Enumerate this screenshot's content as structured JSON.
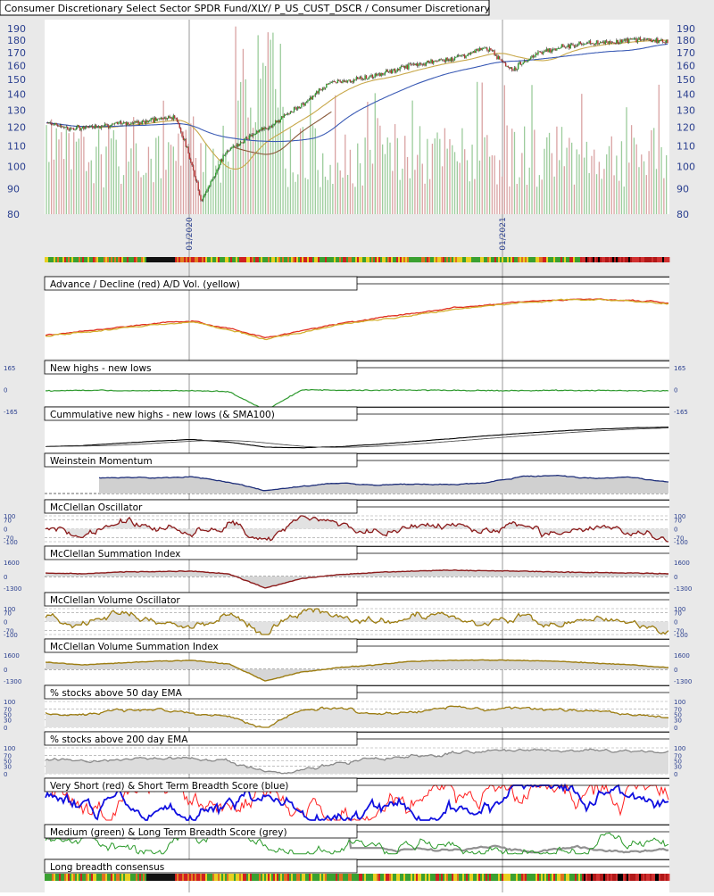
{
  "colors": {
    "background": "#e9e9e9",
    "plot_background": "#ffffff",
    "axis_text": "#2a3f8f",
    "candle_up": "#2e9e2e",
    "candle_down": "#b33333",
    "volume_up": "#9ccc9c",
    "volume_down": "#d9a3a3",
    "sma_gold": "#c8a84a",
    "sma_blue": "#3b5bb5",
    "sma_brown": "#8a5a3a",
    "advance_decline": "#e03020",
    "ad_volume": "#d4b030",
    "nhnl": "#2f9a2f",
    "cumulative": "#000000",
    "weinstein": "#1f2f7a",
    "mcclellan": "#8b1a1a",
    "volume_osc": "#9c7c10",
    "pct50": "#9c7c10",
    "pct200": "#8a8a8a",
    "very_short": "#ff2020",
    "short": "#1010e0",
    "medium": "#2a9a2a",
    "long": "#909090",
    "fill_grey": "#d0d0d0"
  },
  "chart_data": [
    {
      "type": "candlestick",
      "title": "Consumer Discretionary Select Sector SPDR Fund/XLY/ P_US_CUST_DSCR / Consumer Discretionary",
      "y_ticks": [
        190,
        180,
        170,
        160,
        150,
        140,
        130,
        120,
        110,
        100,
        90,
        80
      ],
      "y_scale": "log",
      "ylim": [
        80,
        195
      ],
      "date_labels": [
        "01/2020",
        "01/2021"
      ],
      "series": [
        {
          "name": "price",
          "x": [
            "2019-09",
            "2019-10",
            "2019-11",
            "2019-12",
            "2020-01",
            "2020-02",
            "2020-03",
            "2020-04",
            "2020-05",
            "2020-06",
            "2020-07",
            "2020-08",
            "2020-09",
            "2020-10",
            "2020-11",
            "2020-12",
            "2021-01",
            "2021-02",
            "2021-03",
            "2021-04",
            "2021-05",
            "2021-06",
            "2021-07",
            "2021-08",
            "2021-09"
          ],
          "values": [
            123,
            119,
            121,
            122,
            124,
            126,
            85,
            108,
            116,
            124,
            135,
            148,
            150,
            154,
            160,
            163,
            167,
            174,
            157,
            170,
            175,
            178,
            179,
            181,
            179
          ]
        }
      ],
      "overlays": [
        "SMA (gold)",
        "SMA (blue)",
        "SMA (brown)"
      ],
      "volume": "bars, green up / red down"
    },
    {
      "type": "heatmap",
      "title": "",
      "description_bar": "daily score colors (green / yellow / red / black)"
    },
    {
      "type": "line",
      "title": "Advance / Decline (red) A/D Vol. (yellow)",
      "series": [
        {
          "name": "Advance / Decline",
          "values": [
            0.35,
            0.42,
            0.48,
            0.56,
            0.6,
            0.48,
            0.3,
            0.43,
            0.55,
            0.65,
            0.73,
            0.82,
            0.88,
            0.94,
            0.97,
            0.98,
            0.96,
            0.92
          ]
        },
        {
          "name": "A/D Vol.",
          "values": [
            0.33,
            0.4,
            0.46,
            0.54,
            0.58,
            0.45,
            0.28,
            0.4,
            0.53,
            0.62,
            0.7,
            0.79,
            0.86,
            0.92,
            0.96,
            0.97,
            0.95,
            0.9
          ]
        }
      ]
    },
    {
      "type": "line",
      "title": "New highs - new lows",
      "y_ticks": [
        165,
        0,
        -165
      ],
      "series": [
        {
          "name": "new highs - new lows",
          "values": [
            0,
            5,
            2,
            3,
            0,
            -4,
            -165,
            10,
            5,
            6,
            8,
            4,
            3,
            2,
            4,
            3,
            1,
            0
          ]
        }
      ]
    },
    {
      "type": "line",
      "title": "Cummulative new highs - new lows (& SMA100)",
      "series": [
        {
          "name": "cumulative",
          "values": [
            0.1,
            0.15,
            0.25,
            0.35,
            0.42,
            0.3,
            0.08,
            0.05,
            0.1,
            0.2,
            0.32,
            0.45,
            0.58,
            0.7,
            0.8,
            0.88,
            0.94,
            0.98
          ]
        }
      ]
    },
    {
      "type": "line",
      "title": "Weinstein Momentum",
      "series": [
        {
          "name": "momentum",
          "values": [
            0.5,
            0.75,
            0.8,
            0.78,
            0.82,
            0.6,
            0.2,
            0.4,
            0.55,
            0.45,
            0.5,
            0.48,
            0.55,
            0.85,
            0.88,
            0.75,
            0.82,
            0.6
          ]
        }
      ]
    },
    {
      "type": "line",
      "title": "McClellan Oscillator",
      "y_ticks": [
        100,
        70,
        0,
        -70,
        -100
      ],
      "series": [
        {
          "name": "McClellan Oscillator",
          "values": [
            20,
            -40,
            60,
            10,
            -30,
            50,
            -100,
            90,
            40,
            -30,
            20,
            55,
            -20,
            30,
            -40,
            20,
            -30,
            -60
          ]
        }
      ]
    },
    {
      "type": "line",
      "title": "McClellan Summation Index",
      "y_ticks": [
        1600,
        0,
        -1300
      ],
      "series": [
        {
          "name": "Summation Index",
          "values": [
            400,
            300,
            500,
            550,
            600,
            300,
            -1300,
            -200,
            200,
            450,
            600,
            700,
            650,
            600,
            500,
            450,
            400,
            300
          ]
        }
      ]
    },
    {
      "type": "line",
      "title": "McClellan Volume Oscillator",
      "y_ticks": [
        100,
        70,
        0,
        -70,
        -100
      ],
      "series": [
        {
          "name": "Volume Oscillator",
          "values": [
            30,
            -20,
            70,
            10,
            -40,
            40,
            -100,
            100,
            50,
            -20,
            30,
            60,
            -10,
            40,
            -30,
            20,
            -20,
            -70
          ]
        }
      ]
    },
    {
      "type": "area",
      "title": "McClellan Volume Summation Index",
      "y_ticks": [
        1600,
        0,
        -1300
      ],
      "series": [
        {
          "name": "Volume Summation",
          "values": [
            800,
            500,
            700,
            900,
            1000,
            600,
            -1300,
            -300,
            200,
            500,
            900,
            1000,
            1050,
            1000,
            900,
            700,
            500,
            200
          ]
        }
      ]
    },
    {
      "type": "line",
      "title": "% stocks above 50 day EMA",
      "y_ticks": [
        100,
        70,
        50,
        30,
        0
      ],
      "series": [
        {
          "name": "% above 50 EMA",
          "values": [
            55,
            45,
            60,
            65,
            58,
            40,
            0,
            70,
            75,
            50,
            60,
            80,
            70,
            75,
            65,
            60,
            50,
            35
          ]
        }
      ]
    },
    {
      "type": "area",
      "title": "% stocks above 200 day EMA",
      "y_ticks": [
        100,
        70,
        50,
        30,
        0
      ],
      "series": [
        {
          "name": "% above 200 EMA",
          "values": [
            55,
            48,
            55,
            60,
            62,
            50,
            5,
            15,
            40,
            55,
            65,
            80,
            90,
            94,
            92,
            90,
            88,
            85
          ]
        }
      ]
    },
    {
      "type": "line",
      "title": "Very Short (red) & Short Term Breadth Score (blue)",
      "series": [
        {
          "name": "Very Short",
          "values": []
        },
        {
          "name": "Short",
          "values": []
        }
      ]
    },
    {
      "type": "line",
      "title": "Medium (green) & Long Term Breadth Score (grey)",
      "series": [
        {
          "name": "Medium",
          "values": []
        },
        {
          "name": "Long",
          "values": []
        }
      ]
    },
    {
      "type": "heatmap",
      "title": "Long breadth consensus"
    }
  ]
}
